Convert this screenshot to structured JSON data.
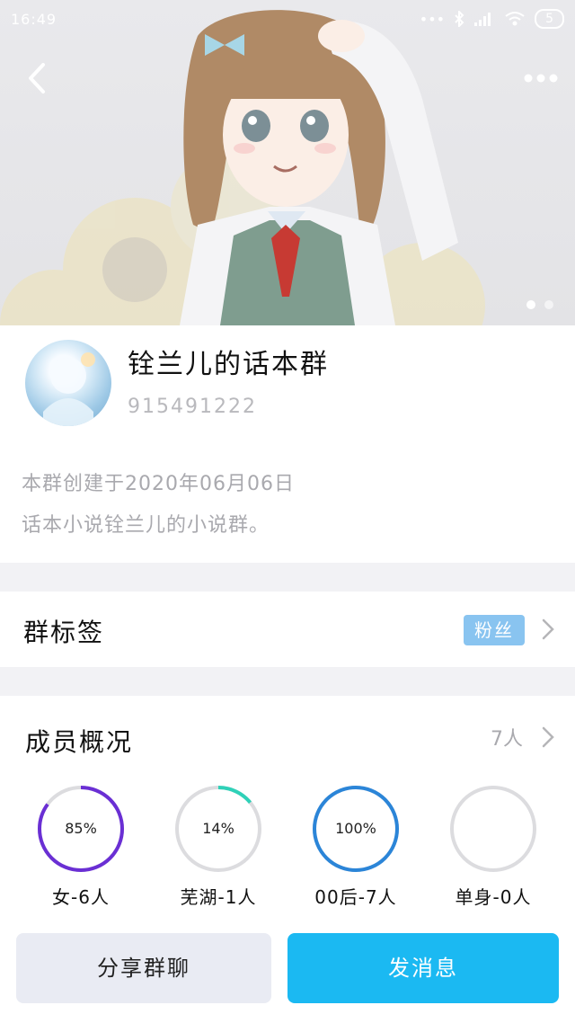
{
  "status_bar": {
    "time": "16:49",
    "battery": "5"
  },
  "group": {
    "name": "铨兰儿的话本群",
    "id": "915491222",
    "description_lines": [
      "本群创建于2020年06月06日",
      "话本小说铨兰儿的小说群。"
    ]
  },
  "tags_row": {
    "title": "群标签",
    "tag": "粉丝"
  },
  "members": {
    "title": "成员概况",
    "count": "7人",
    "stats": [
      {
        "percent_label": "85%",
        "label": "女-6人",
        "percent": 85,
        "color": "#6a2fd4"
      },
      {
        "percent_label": "14%",
        "label": "芜湖-1人",
        "percent": 14,
        "color": "#2fd1b8"
      },
      {
        "percent_label": "100%",
        "label": "00后-7人",
        "percent": 100,
        "color": "#2b85d8"
      },
      {
        "percent_label": "",
        "label": "单身-0人",
        "percent": 0,
        "color": "#cccccc"
      }
    ]
  },
  "actions": {
    "share_label": "分享群聊",
    "send_label": "发消息"
  },
  "icons": [
    "back-arrow-icon",
    "more-dots-icon",
    "chevron-right-icon",
    "bluetooth-icon",
    "signal-icon",
    "wifi-icon",
    "battery-icon"
  ]
}
